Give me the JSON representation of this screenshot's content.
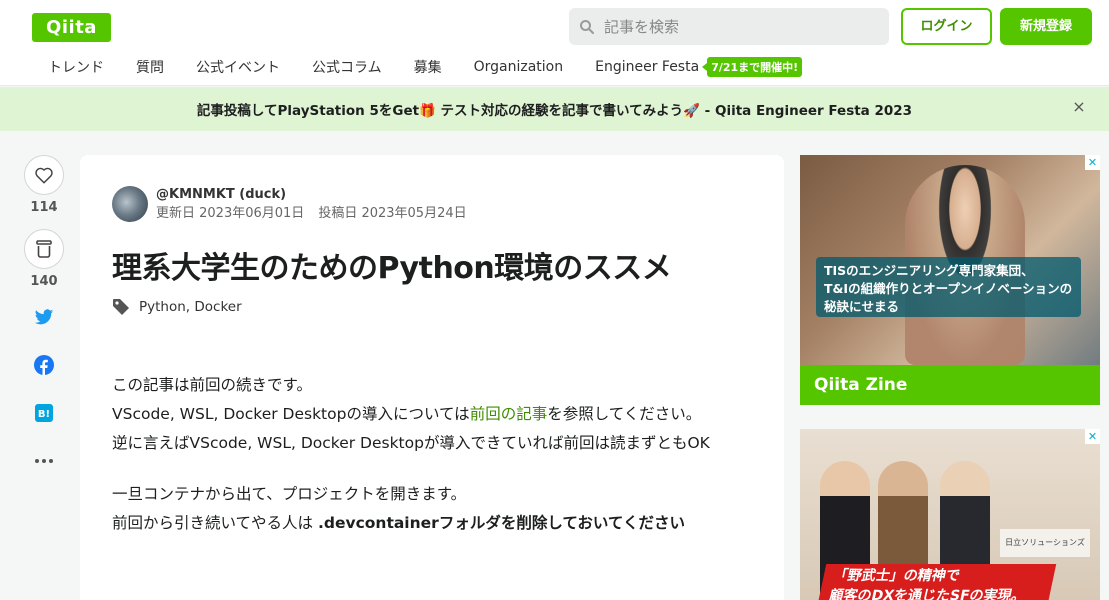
{
  "header": {
    "logo": "Qiita",
    "search_placeholder": "記事を検索",
    "login_label": "ログイン",
    "signup_label": "新規登録",
    "nav": [
      "トレンド",
      "質問",
      "公式イベント",
      "公式コラム",
      "募集",
      "Organization",
      "Engineer Festa"
    ],
    "fest_badge": "7/21まで開催中!"
  },
  "banner": {
    "text": "記事投稿してPlayStation 5をGet🎁 テスト対応の経験を記事で書いてみよう🚀 - Qiita Engineer Festa 2023",
    "close": "×"
  },
  "side": {
    "likes": "114",
    "stocks": "140"
  },
  "article": {
    "author": "@KMNMKT (duck)",
    "updated": "更新日 2023年06月01日",
    "posted": "投稿日 2023年05月24日",
    "title": "理系大学生のためのPython環境のススメ",
    "tags": [
      "Python",
      "Docker"
    ],
    "line1": "この記事は前回の続きです。",
    "line2_pre": "VScode, WSL, Docker Desktopの導入については",
    "line2_link": "前回の記事",
    "line2_post": "を参照してください。",
    "line3": "逆に言えばVScode, WSL, Docker Desktopが導入できていれば前回は読まずともOK",
    "line4": "一旦コンテナから出て、プロジェクトを開きます。",
    "line5_pre": "前回から引き続いてやる人は ",
    "line5_bold": ".devcontainerフォルダを削除しておいてください"
  },
  "ads": {
    "ad1_caption_1": "TISのエンジニアリング専門家集団、",
    "ad1_caption_2": "T&Iの組織作りとオープンイノベーションの",
    "ad1_caption_3": "秘訣にせまる",
    "ad1_brand": "Qiita Zine",
    "ad2_sign": "日立ソリューションズ",
    "ad2_text_1": "「野武士」の精神で",
    "ad2_text_2": "顧客のDXを通じたSFの実現。",
    "close": "✕"
  },
  "colors": {
    "brand": "#55c500",
    "link": "#3e8e00",
    "banner_bg": "#dff4d3",
    "twitter": "#1d9bf0",
    "facebook": "#1877f2",
    "hatena": "#00a4de"
  }
}
